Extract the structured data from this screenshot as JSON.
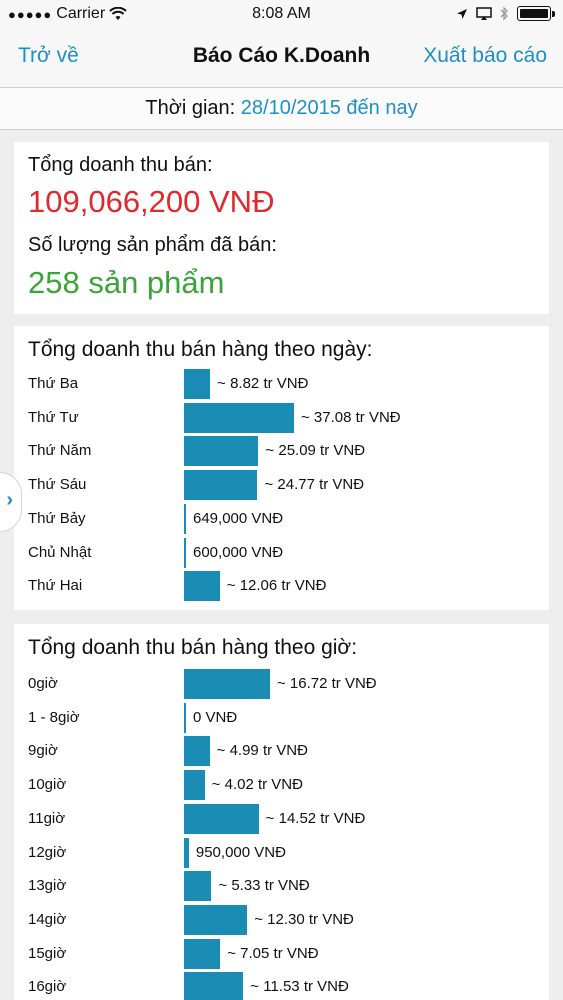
{
  "status": {
    "signal_dots": "●●●●●",
    "carrier": "Carrier",
    "time": "8:08 AM",
    "icons": [
      "wifi-icon",
      "location-icon",
      "airplay-icon",
      "bluetooth-icon",
      "battery-icon"
    ]
  },
  "nav": {
    "back": "Trở về",
    "title": "Báo Cáo K.Doanh",
    "export": "Xuất báo cáo"
  },
  "time_filter": {
    "label": "Thời gian:",
    "value": "28/10/2015 đến nay"
  },
  "summary": {
    "revenue_label": "Tổng doanh thu bán:",
    "revenue_value": "109,066,200 VNĐ",
    "qty_label": "Số lượng sản phẩm đã bán:",
    "qty_value": "258 sản phẩm"
  },
  "colors": {
    "accent": "#1f8fc7",
    "bar": "#1b8db4",
    "revenue": "#e0282e",
    "quantity": "#3aa43a"
  },
  "by_day": {
    "title": "Tổng doanh thu bán hàng theo ngày:",
    "rows": [
      {
        "name": "Thứ Ba",
        "amount": "~ 8.82 tr VNĐ",
        "value": 8.82
      },
      {
        "name": "Thứ Tư",
        "amount": "~ 37.08 tr VNĐ",
        "value": 37.08
      },
      {
        "name": "Thứ Năm",
        "amount": "~ 25.09 tr VNĐ",
        "value": 25.09
      },
      {
        "name": "Thứ Sáu",
        "amount": "~ 24.77 tr VNĐ",
        "value": 24.77
      },
      {
        "name": "Thứ Bảy",
        "amount": "649,000 VNĐ",
        "value": 0.649
      },
      {
        "name": "Chủ Nhật",
        "amount": "600,000 VNĐ",
        "value": 0.6
      },
      {
        "name": "Thứ Hai",
        "amount": "~ 12.06 tr VNĐ",
        "value": 12.06
      }
    ]
  },
  "by_hour": {
    "title": "Tổng doanh thu bán hàng theo giờ:",
    "rows": [
      {
        "name": "0giờ",
        "amount": "~ 16.72 tr VNĐ",
        "value": 16.72
      },
      {
        "name": "1 - 8giờ",
        "amount": "0 VNĐ",
        "value": 0
      },
      {
        "name": "9giờ",
        "amount": "~ 4.99 tr VNĐ",
        "value": 4.99
      },
      {
        "name": "10giờ",
        "amount": "~ 4.02 tr VNĐ",
        "value": 4.02
      },
      {
        "name": "11giờ",
        "amount": "~ 14.52 tr VNĐ",
        "value": 14.52
      },
      {
        "name": "12giờ",
        "amount": "950,000 VNĐ",
        "value": 0.95
      },
      {
        "name": "13giờ",
        "amount": "~ 5.33 tr VNĐ",
        "value": 5.33
      },
      {
        "name": "14giờ",
        "amount": "~ 12.30 tr VNĐ",
        "value": 12.3
      },
      {
        "name": "15giờ",
        "amount": "~ 7.05 tr VNĐ",
        "value": 7.05
      },
      {
        "name": "16giờ",
        "amount": "~ 11.53 tr VNĐ",
        "value": 11.53
      }
    ]
  }
}
